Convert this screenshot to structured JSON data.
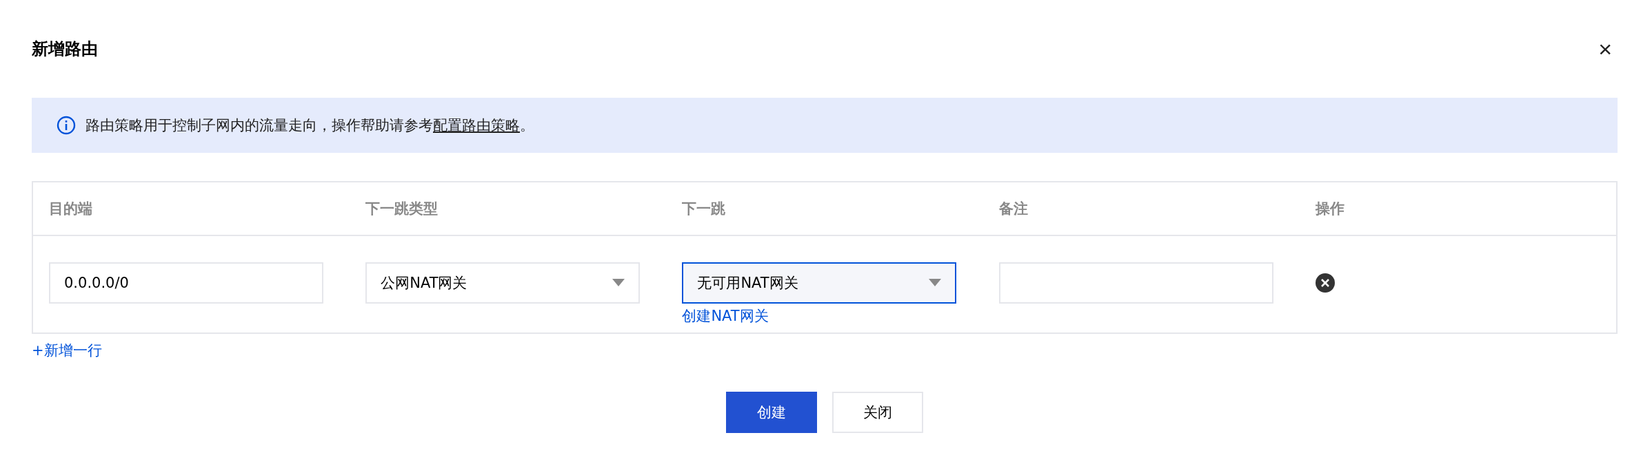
{
  "dialog": {
    "title": "新增路由",
    "close": "×"
  },
  "notice": {
    "text": "路由策略用于控制子网内的流量走向，操作帮助请参考",
    "link": "配置路由策略",
    "suffix": "。"
  },
  "table": {
    "columns": [
      "目的端",
      "下一跳类型",
      "下一跳",
      "备注",
      "操作"
    ],
    "rows": [
      {
        "destination": {
          "kind": "input",
          "value": "0.0.0.0/0"
        },
        "next_hop_type": {
          "kind": "select",
          "value": "公网NAT网关",
          "focused": false
        },
        "next_hop": {
          "kind": "select",
          "value": "无可用NAT网关",
          "focused": true,
          "link": "创建NAT网关"
        },
        "remark": {
          "kind": "input"
        },
        "action": {
          "kind": "delete"
        }
      }
    ]
  },
  "add_row": "+新增一行",
  "buttons": [
    {
      "label": "创建",
      "kind": "primary"
    },
    {
      "label": "关闭",
      "kind": "default"
    }
  ]
}
